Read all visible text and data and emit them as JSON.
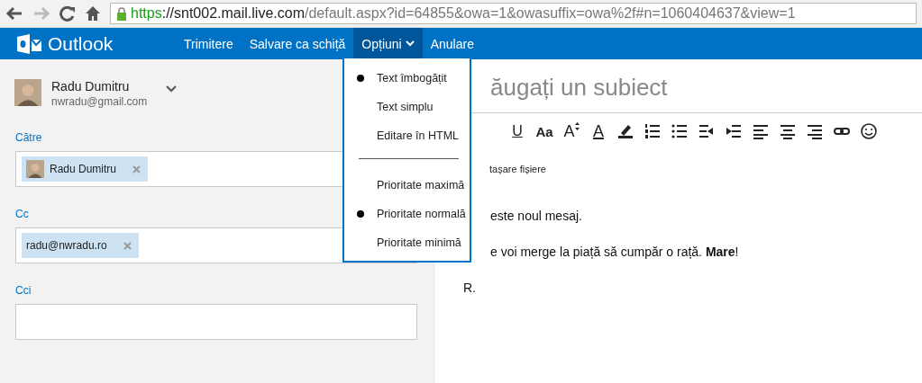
{
  "browser": {
    "url": {
      "scheme": "https",
      "host": "://snt002.mail.live.com",
      "path": "/default.aspx?id=64855&owa=1&owasuffix=owa%2f#n=1060404637&view=1"
    }
  },
  "app": {
    "name": "Outlook"
  },
  "nav": [
    {
      "label": "Trimitere",
      "selected": false,
      "dropdown": false
    },
    {
      "label": "Salvare ca schiță",
      "selected": false,
      "dropdown": false
    },
    {
      "label": "Opțiuni",
      "selected": true,
      "dropdown": true
    },
    {
      "label": "Anulare",
      "selected": false,
      "dropdown": false
    }
  ],
  "sender": {
    "name": "Radu Dumitru",
    "email": "nwradu@gmail.com"
  },
  "fields": [
    {
      "label": "Către",
      "recipients": [
        {
          "name": "Radu Dumitru",
          "avatar": true
        }
      ]
    },
    {
      "label": "Cc",
      "recipients": [
        {
          "name": "radu@nwradu.ro",
          "avatar": false
        }
      ]
    },
    {
      "label": "Cci"
    }
  ],
  "subject": {
    "placeholder": "ăugați un subiect"
  },
  "toolbar": [
    {
      "kind": "underline",
      "label": "U"
    },
    {
      "kind": "font",
      "label": "Aa"
    },
    {
      "kind": "size",
      "label": "A"
    },
    {
      "kind": "color",
      "label": "A"
    },
    {
      "kind": "highlight"
    },
    {
      "kind": "numbered"
    },
    {
      "kind": "bullets"
    },
    {
      "kind": "outdent"
    },
    {
      "kind": "indent"
    },
    {
      "kind": "align-left"
    },
    {
      "kind": "align-center"
    },
    {
      "kind": "align-right"
    },
    {
      "kind": "link"
    },
    {
      "kind": "emoji"
    }
  ],
  "attach": {
    "label": "tașare fișiere"
  },
  "body": [
    {
      "kind": "partial",
      "text": "este noul mesaj."
    },
    {
      "kind": "partial",
      "text": "e voi merge la piață să cumpăr o rață. **Mare**!"
    },
    {
      "kind": "full",
      "text": "R."
    }
  ],
  "menu": [
    [
      {
        "label": "Text îmbogățit",
        "selected": true
      },
      {
        "label": "Text simplu",
        "selected": false
      },
      {
        "label": "Editare în HTML",
        "selected": false
      }
    ],
    [
      {
        "label": "Prioritate maximă",
        "selected": false
      },
      {
        "label": "Prioritate normală",
        "selected": true
      },
      {
        "label": "Prioritate minimă",
        "selected": false
      }
    ]
  ]
}
